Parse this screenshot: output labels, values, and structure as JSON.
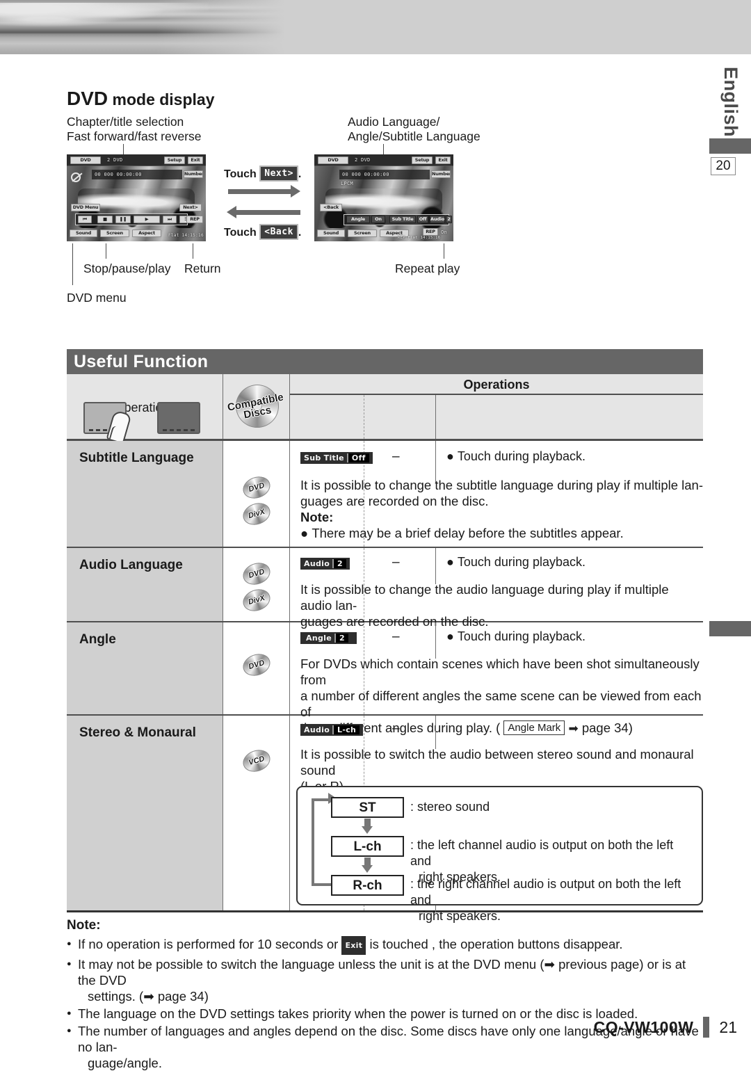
{
  "side_tab": {
    "language": "English",
    "page_ref": "20"
  },
  "section": {
    "title_strong": "DVD",
    "title_rest": "mode display",
    "callouts": {
      "top_left": "Chapter/title selection\nFast forward/fast reverse",
      "top_left_line1": "Chapter/title selection",
      "top_left_line2": "Fast forward/fast reverse",
      "top_right_line1": "Audio Language/",
      "top_right_line2": "Angle/Subtitle Language",
      "stop_pause_play": "Stop/pause/play",
      "return": "Return",
      "repeat_play": "Repeat play",
      "dvd_menu": "DVD menu"
    },
    "touch_next_label": "Touch",
    "touch_next_key": "Next>",
    "touch_next_period": ".",
    "touch_back_label": "Touch",
    "touch_back_key": "<Back",
    "touch_back_period": "."
  },
  "screen1": {
    "source": "DVD",
    "disc_info": "2   DVD",
    "setup": "Setup",
    "exit": "Exit",
    "number": "Number",
    "osd": "00    000  00:00:00",
    "dvd_menu_btn": "DVD Menu",
    "next_btn": "Next>",
    "rep_btn": "REP",
    "sound": "Sound",
    "screen": "Screen",
    "aspect": "Aspect",
    "status": "Flat  14:15:16"
  },
  "screen2": {
    "source": "DVD",
    "disc_info": "2   DVD",
    "setup": "Setup",
    "exit": "Exit",
    "number": "Number",
    "osd": "00    000  00:00:00",
    "audio_format": "LPCM",
    "back_btn": "<Back",
    "angle_label": "Angle",
    "angle_value": "On",
    "subtitle_label": "Sub Title",
    "subtitle_value": "Off",
    "audio_label": "Audio",
    "audio_value": "2",
    "sound": "Sound",
    "screen": "Screen",
    "aspect": "Aspect",
    "rep_btn": "REP",
    "rep_value": "On",
    "status": "REP   Flat  14:15:16"
  },
  "useful_function": {
    "banner": "Useful Function",
    "header": {
      "col_operations": "Operations",
      "col_compatible_line1": "Compatible",
      "col_compatible_line2": "Discs",
      "col_operations_group": "Operations"
    },
    "rows": [
      {
        "title": "Subtitle Language",
        "discs": [
          "DVD",
          "DivX"
        ],
        "chip_label": "Sub Title",
        "chip_value": "Off",
        "dash": "–",
        "touch_note": "Touch during playback.",
        "body_line1": "It is possible to change the subtitle language during play if multiple lan-",
        "body_line2": "guages are recorded on the disc.",
        "note_label": "Note:",
        "note_bullet": "There may be a brief delay before the subtitles appear."
      },
      {
        "title": "Audio Language",
        "discs": [
          "DVD",
          "DivX"
        ],
        "chip_label": "Audio",
        "chip_value": "2",
        "dash": "–",
        "touch_note": "Touch during playback.",
        "body_line1": "It is possible to change the audio language during play if multiple audio lan-",
        "body_line2": "guages are recorded on the disc."
      },
      {
        "title": "Angle",
        "discs": [
          "DVD"
        ],
        "chip_label": "Angle",
        "chip_value": "2",
        "dash": "–",
        "touch_note": "Touch during playback.",
        "body_line1": "For DVDs which contain scenes which have been shot simultaneously from",
        "body_line2": "a number of different angles the same scene can be viewed from each of",
        "body_line3_pre": "these different angles during play. (",
        "body_line3_box": "Angle Mark",
        "body_line3_post": "page 34)"
      },
      {
        "title": "Stereo & Monaural",
        "discs": [
          "VCD"
        ],
        "chip_label": "Audio",
        "chip_value": "L-ch",
        "dash": "–",
        "body_line1": "It is possible to switch the audio between stereo sound and monaural sound",
        "body_line2": "(L or R).",
        "flow": [
          {
            "key": "ST",
            "desc_line1": ": stereo sound",
            "desc_line2": ""
          },
          {
            "key": "L-ch",
            "desc_line1": ": the left channel audio is output on both the left and",
            "desc_line2": "right speakers."
          },
          {
            "key": "R-ch",
            "desc_line1": ": the right channel audio is output on both the left and",
            "desc_line2": "right speakers."
          }
        ]
      }
    ]
  },
  "notes": {
    "label": "Note:",
    "items": [
      {
        "pre": "If no operation is performed for 10 seconds or ",
        "chip": "Exit",
        "post": " is touched , the operation buttons disappear.",
        "second_line": ""
      },
      {
        "pre": "It may not be possible to switch the language unless the unit is at the DVD menu (➡ previous page) or is at the DVD",
        "chip": "",
        "post": "",
        "second_line": "settings. (➡ page 34)"
      },
      {
        "pre": "The language on the DVD settings takes priority when the power is turned on or the disc is loaded.",
        "chip": "",
        "post": "",
        "second_line": ""
      },
      {
        "pre": "The number of languages and angles depend on the disc. Some discs have only one language/angle or have no lan-",
        "chip": "",
        "post": "",
        "second_line": "guage/angle."
      }
    ]
  },
  "footer": {
    "model": "CQ-VW100W",
    "page": "21"
  },
  "colors": {
    "banner_bg": "#666666",
    "row_label_bg": "#d0d0d0",
    "rule": "#4f4f4f"
  }
}
